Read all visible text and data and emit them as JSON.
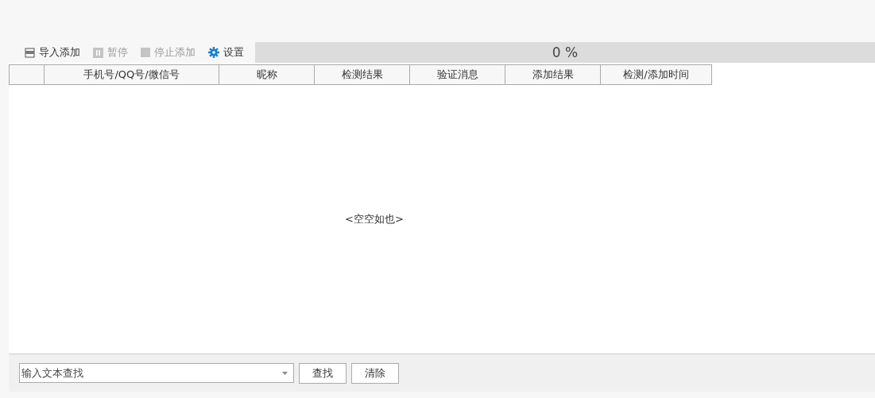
{
  "toolbar": [
    {
      "kind": "import",
      "label": "导入添加",
      "disabled": false
    },
    {
      "kind": "pause",
      "label": "暂停",
      "disabled": true
    },
    {
      "kind": "stop",
      "label": "停止添加",
      "disabled": true
    },
    {
      "kind": "settings",
      "label": "设置",
      "disabled": false
    }
  ],
  "progress": {
    "reading": "0 %"
  },
  "table": {
    "columns": [
      "",
      "手机号/QQ号/微信号",
      "昵称",
      "检测结果",
      "验证消息",
      "添加结果",
      "检测/添加时间"
    ],
    "empty_text": "<空空如也>"
  },
  "search": {
    "placeholder": "输入文本查找"
  },
  "buttons": [
    "查找",
    "清除"
  ]
}
